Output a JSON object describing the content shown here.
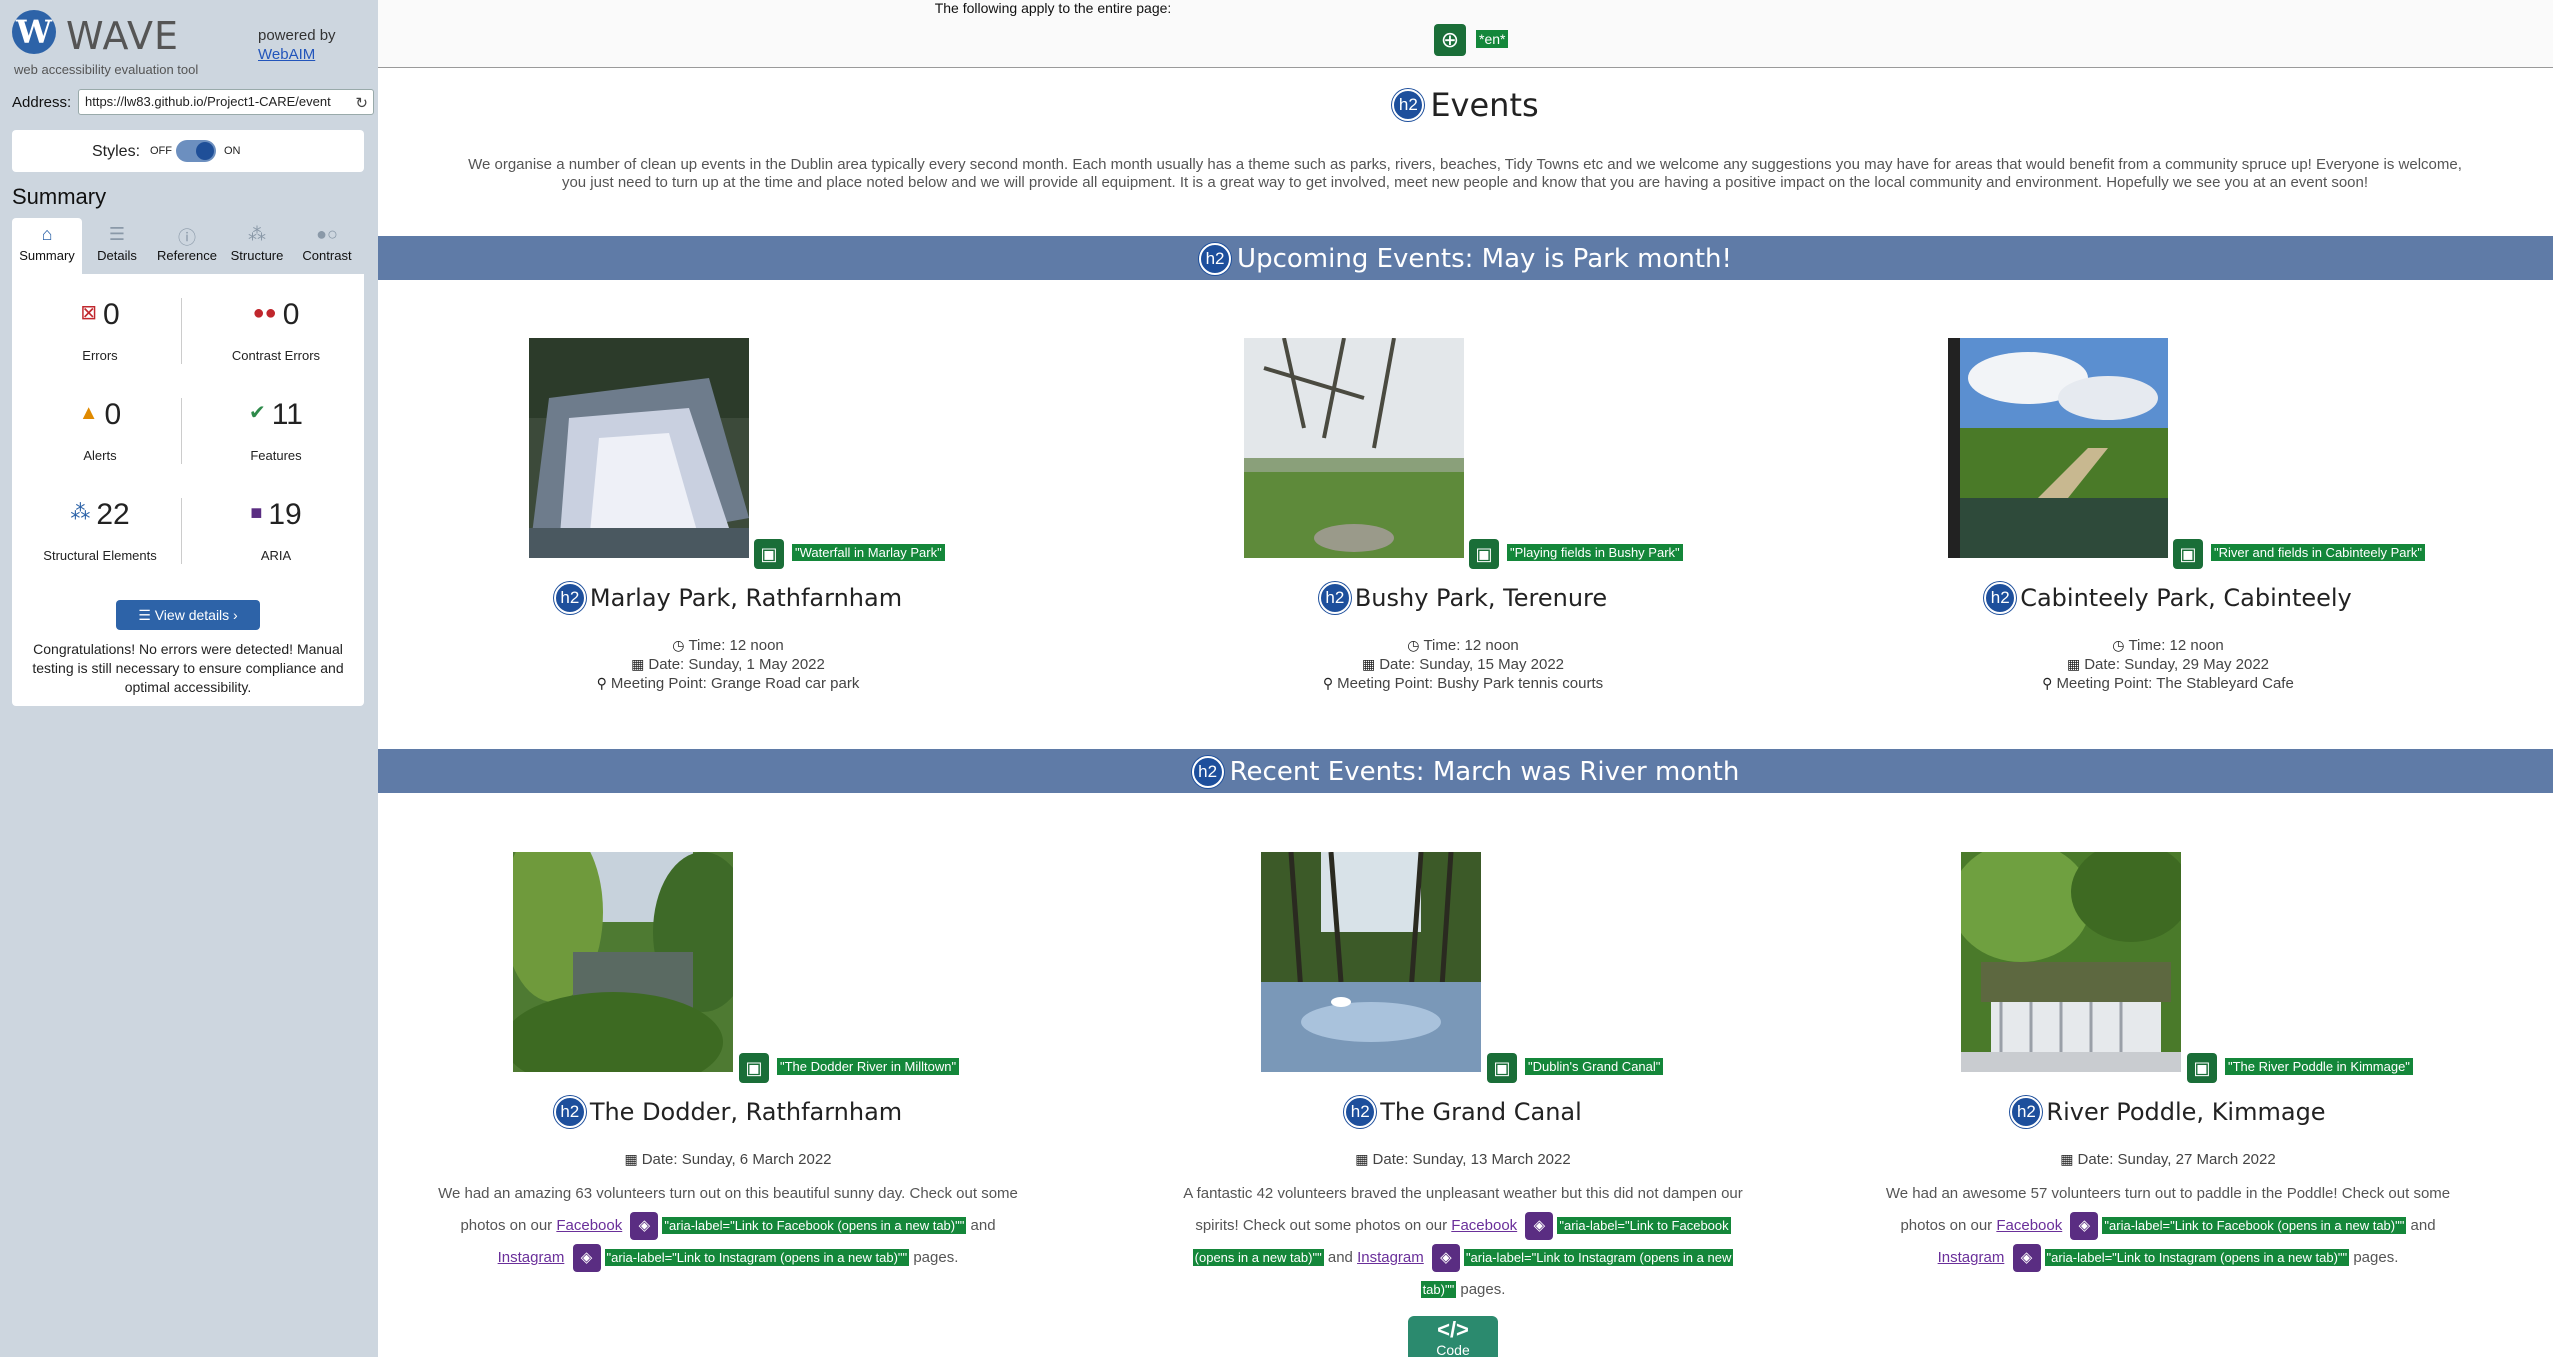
{
  "wave": {
    "logo_letter": "W",
    "logo_name": "WAVE",
    "logo_sub": "web accessibility evaluation tool",
    "powered_by": "powered by",
    "webaim": "WebAIM",
    "address_label": "Address:",
    "address_value": "https://lw83.github.io/Project1-CARE/event",
    "styles_label": "Styles:",
    "styles_off": "OFF",
    "styles_on": "ON",
    "summary_title": "Summary",
    "tabs": [
      {
        "label": "Summary",
        "icon": "home-icon"
      },
      {
        "label": "Details",
        "icon": "list-icon"
      },
      {
        "label": "Reference",
        "icon": "info-icon"
      },
      {
        "label": "Structure",
        "icon": "structure-icon"
      },
      {
        "label": "Contrast",
        "icon": "contrast-icon"
      }
    ],
    "stats": [
      {
        "count": "0",
        "label": "Errors",
        "color": "#c0272d"
      },
      {
        "count": "0",
        "label": "Contrast Errors",
        "color": "#c0272d"
      },
      {
        "count": "0",
        "label": "Alerts",
        "color": "#e08a00"
      },
      {
        "count": "11",
        "label": "Features",
        "color": "#2e8a4a"
      },
      {
        "count": "22",
        "label": "Structural Elements",
        "color": "#2d63a8"
      },
      {
        "count": "19",
        "label": "ARIA",
        "color": "#5a2d82"
      }
    ],
    "view_details": "View details ›",
    "congrats": "Congratulations! No errors were detected! Manual testing is still necessary to ensure compliance and optimal accessibility."
  },
  "page": {
    "apply_text": "The following apply to the entire page:",
    "lang": "*en*",
    "h2_badge": "h2",
    "events_title": "Events",
    "intro": "We organise a number of clean up events in the Dublin area typically every second month. Each month usually has a theme such as parks, rivers, beaches, Tidy Towns etc and we welcome any suggestions you may have for areas that would benefit from a community spruce up! Everyone is welcome, you just need to turn up at the time and place noted below and we will provide all equipment. It is a great way to get involved, meet new people and know that you are having a positive impact on the local community and environment. Hopefully we see you at an event soon!",
    "upcoming_title": "Upcoming Events: May is Park month!",
    "recent_title": "Recent Events: March was River month",
    "upcoming": [
      {
        "alt": "\"Waterfall in Marlay Park\"",
        "title": "Marlay Park, Rathfarnham",
        "time": "Time: 12 noon",
        "date": "Date: Sunday, 1 May 2022",
        "meeting": "Meeting Point: Grange Road car park"
      },
      {
        "alt": "\"Playing fields in Bushy Park\"",
        "title": "Bushy Park, Terenure",
        "time": "Time: 12 noon",
        "date": "Date: Sunday, 15 May 2022",
        "meeting": "Meeting Point: Bushy Park tennis courts"
      },
      {
        "alt": "\"River and fields in Cabinteely Park\"",
        "title": "Cabinteely Park, Cabinteely",
        "time": "Time: 12 noon",
        "date": "Date: Sunday, 29 May 2022",
        "meeting": "Meeting Point: The Stableyard Cafe"
      }
    ],
    "recent": [
      {
        "alt": "\"The Dodder River in Milltown\"",
        "title": "The Dodder, Rathfarnham",
        "date": "Date: Sunday, 6 March 2022",
        "text1": "We had an amazing 63 volunteers turn out on this beautiful sunny day. Check out some",
        "text2": "photos on our",
        "facebook": "Facebook",
        "fb_aria": "\"aria-label=\"Link to Facebook (opens in a new tab)\"\"",
        "and": "and",
        "instagram": "Instagram",
        "ig_aria": "\"aria-label=\"Link to Instagram (opens in a new tab)\"\"",
        "pages": "pages."
      },
      {
        "alt": "\"Dublin's Grand Canal\"",
        "title": "The Grand Canal",
        "date": "Date: Sunday, 13 March 2022",
        "text1": "A fantastic 42 volunteers braved the unpleasant weather but this did not dampen our",
        "text2": "spirits! Check out some photos on our",
        "facebook": "Facebook",
        "fb_aria_a": "\"aria-label=\"Link to Facebook",
        "fb_aria_b": "(opens in a new tab)\"\"",
        "and": "and",
        "instagram": "Instagram",
        "ig_aria_a": "\"aria-label=\"Link to Instagram (opens in a new",
        "ig_aria_b": "tab)\"\"",
        "pages": "pages."
      },
      {
        "alt": "\"The River Poddle in Kimmage\"",
        "title": "River Poddle, Kimmage",
        "date": "Date: Sunday, 27 March 2022",
        "text1": "We had an awesome 57 volunteers turn out to paddle in the Poddle! Check out some",
        "text2": "photos on our",
        "facebook": "Facebook",
        "fb_aria": "\"aria-label=\"Link to Facebook (opens in a new tab)\"\"",
        "and": "and",
        "instagram": "Instagram",
        "ig_aria": "\"aria-label=\"Link to Instagram (opens in a new tab)\"\"",
        "pages": "pages."
      }
    ],
    "code_label": "Code"
  }
}
